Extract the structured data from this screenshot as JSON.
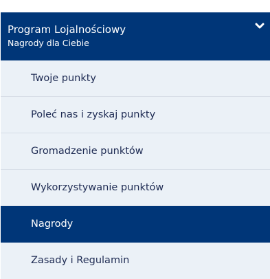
{
  "colors": {
    "primary": "#003678",
    "item_background": "#ebf1f7",
    "item_text": "#1d2a52",
    "divider": "#d6dde6"
  },
  "menu": {
    "title": "Program Lojalnościowy",
    "subtitle": "Nagrody dla Ciebie",
    "toggle_icon": "chevron-down-icon",
    "items": [
      {
        "label": "Twoje punkty",
        "active": false
      },
      {
        "label": "Poleć nas i zyskaj punkty",
        "active": false
      },
      {
        "label": "Gromadzenie punktów",
        "active": false
      },
      {
        "label": "Wykorzystywanie punktów",
        "active": false
      },
      {
        "label": "Nagrody",
        "active": true
      },
      {
        "label": "Zasady i Regulamin",
        "active": false
      }
    ]
  }
}
